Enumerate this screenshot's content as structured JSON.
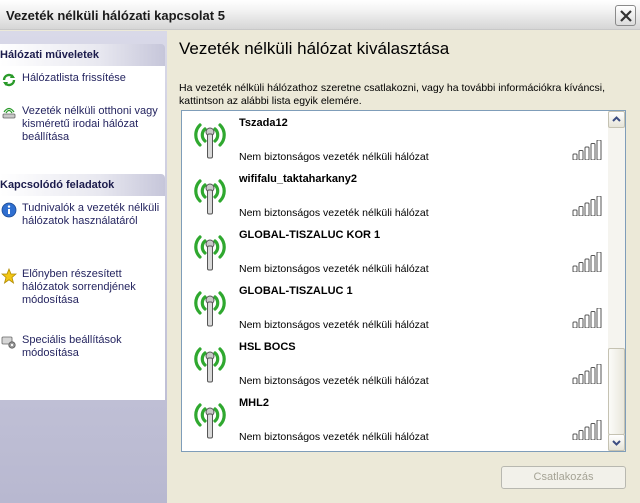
{
  "window": {
    "title": "Vezeték nélküli hálózati kapcsolat 5"
  },
  "sidebar": {
    "groups": [
      {
        "header": "Hálózati műveletek",
        "items": [
          {
            "label": "Hálózatlista frissítése",
            "icon": "refresh-icon"
          },
          {
            "label": "Vezeték nélküli otthoni vagy kisméretű irodai hálózat beállítása",
            "icon": "home-network-icon"
          }
        ]
      },
      {
        "header": "Kapcsolódó feladatok",
        "items": [
          {
            "label": "Tudnivalók a vezeték nélküli hálózatok használatáról",
            "icon": "info-icon"
          },
          {
            "label": "Előnyben részesített hálózatok sorrendjének módosítása",
            "icon": "star-icon"
          },
          {
            "label": "Speciális beállítások módosítása",
            "icon": "advanced-settings-icon"
          }
        ]
      }
    ]
  },
  "main": {
    "title": "Vezeték nélküli hálózat kiválasztása",
    "instructions": "Ha vezeték nélküli hálózathoz szeretne csatlakozni, vagy ha további információkra kíváncsi, kattintson az alábbi lista egyik elemére.",
    "networks": [
      {
        "ssid": "Tszada12",
        "security": "Nem biztonságos vezeték nélküli hálózat",
        "signal_bars": 5
      },
      {
        "ssid": "wififalu_taktaharkany2",
        "security": "Nem biztonságos vezeték nélküli hálózat",
        "signal_bars": 5
      },
      {
        "ssid": "GLOBAL-TISZALUC KOR 1",
        "security": "Nem biztonságos vezeték nélküli hálózat",
        "signal_bars": 5
      },
      {
        "ssid": "GLOBAL-TISZALUC 1",
        "security": "Nem biztonságos vezeték nélküli hálózat",
        "signal_bars": 5
      },
      {
        "ssid": "HSL BOCS",
        "security": "Nem biztonságos vezeték nélküli hálózat",
        "signal_bars": 5
      },
      {
        "ssid": "MHL2",
        "security": "Nem biztonságos vezeték nélküli hálózat",
        "signal_bars": 5
      }
    ],
    "connect_label": "Csatlakozás"
  },
  "colors": {
    "signal_green": "#2fa82f",
    "link_text": "#252560",
    "disabled_text": "#a5a395"
  }
}
